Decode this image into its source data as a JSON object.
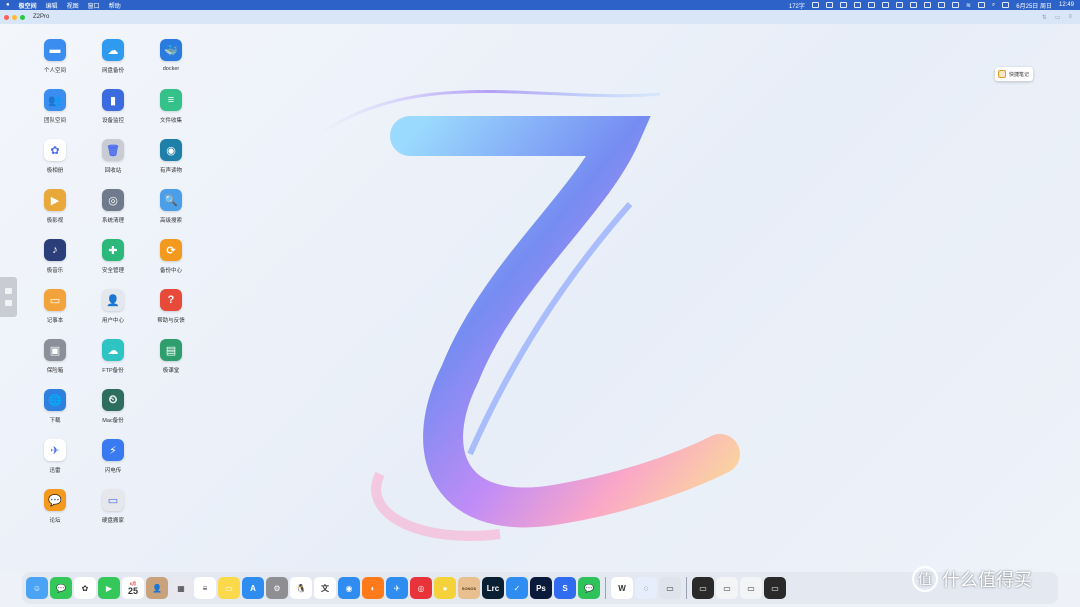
{
  "menubar": {
    "app_name": "极空间",
    "items": [
      "编辑",
      "视图",
      "窗口",
      "帮助"
    ],
    "status": {
      "input_method": "172字",
      "datetime": "6月25日 周日",
      "time": "12:49"
    }
  },
  "titlebar": {
    "device_name": "Z2Pro",
    "traffic_colors": [
      "#ff5f57",
      "#febc2e",
      "#28c840"
    ]
  },
  "desktop_apps": [
    {
      "label": "个人空间",
      "icon": "folder-icon",
      "color": "#3b8ef0",
      "glyph": "▬"
    },
    {
      "label": "网盘备份",
      "icon": "cloud-download-icon",
      "color": "#2f9bf0",
      "glyph": "☁"
    },
    {
      "label": "docker",
      "icon": "docker-icon",
      "color": "#2a7bdf",
      "glyph": "🐳"
    },
    {
      "label": "团队空间",
      "icon": "team-folder-icon",
      "color": "#3b8ef0",
      "glyph": "👥"
    },
    {
      "label": "设备监控",
      "icon": "bar-chart-icon",
      "color": "#3a6ce0",
      "glyph": "▮"
    },
    {
      "label": "文件收集",
      "icon": "file-stack-icon",
      "color": "#34c28a",
      "glyph": "≡"
    },
    {
      "label": "极相册",
      "icon": "photos-icon",
      "color": "#ffffff",
      "glyph": "✿"
    },
    {
      "label": "回收站",
      "icon": "trash-icon",
      "color": "#c9ccd2",
      "glyph": "🗑"
    },
    {
      "label": "有声读物",
      "icon": "audiobook-icon",
      "color": "#1e7fa8",
      "glyph": "◉"
    },
    {
      "label": "极影视",
      "icon": "video-icon",
      "color": "#e8a93a",
      "glyph": "▶"
    },
    {
      "label": "系统清理",
      "icon": "cleanup-icon",
      "color": "#6f7b8c",
      "glyph": "◎"
    },
    {
      "label": "高级搜索",
      "icon": "search-icon",
      "color": "#4b9ee8",
      "glyph": "🔍"
    },
    {
      "label": "极音乐",
      "icon": "music-icon",
      "color": "#2c3e7a",
      "glyph": "♪"
    },
    {
      "label": "安全管理",
      "icon": "shield-icon",
      "color": "#2cb87a",
      "glyph": "✚"
    },
    {
      "label": "备份中心",
      "icon": "backup-sync-icon",
      "color": "#f39a1e",
      "glyph": "⟳"
    },
    {
      "label": "记事本",
      "icon": "notepad-icon",
      "color": "#f3a33b",
      "glyph": "▭"
    },
    {
      "label": "用户中心",
      "icon": "user-avatar-icon",
      "color": "#e4e7ec",
      "glyph": "👤"
    },
    {
      "label": "帮助与反馈",
      "icon": "help-lifebuoy-icon",
      "color": "#e84a3a",
      "glyph": "?"
    },
    {
      "label": "保险箱",
      "icon": "safe-icon",
      "color": "#8a8f99",
      "glyph": "▣"
    },
    {
      "label": "FTP备份",
      "icon": "ftp-cloud-icon",
      "color": "#2fc4c4",
      "glyph": "☁"
    },
    {
      "label": "极课堂",
      "icon": "classroom-icon",
      "color": "#2f9e6e",
      "glyph": "▤"
    },
    {
      "label": "下载",
      "icon": "download-globe-icon",
      "color": "#2f7fe0",
      "glyph": "🌐"
    },
    {
      "label": "Mac备份",
      "icon": "time-machine-icon",
      "color": "#2e6e5e",
      "glyph": "⏲"
    },
    null,
    {
      "label": "迅雷",
      "icon": "thunder-bird-icon",
      "color": "#ffffff",
      "glyph": "✈"
    },
    {
      "label": "闪电传",
      "icon": "flash-transfer-icon",
      "color": "#3a7af0",
      "glyph": "⚡"
    },
    null,
    {
      "label": "论坛",
      "icon": "forum-chat-icon",
      "color": "#f39a1e",
      "glyph": "💬"
    },
    {
      "label": "硬盘搬家",
      "icon": "disk-move-icon",
      "color": "#e5e7eb",
      "glyph": "▭"
    },
    null
  ],
  "quick_note": {
    "label": "快捷笔记"
  },
  "dock": {
    "items": [
      {
        "name": "finder-icon",
        "color": "#4aa3f5",
        "glyph": "☺"
      },
      {
        "name": "messages-icon",
        "color": "#34c759",
        "glyph": "💬"
      },
      {
        "name": "photos-icon",
        "color": "#ffffff",
        "glyph": "✿"
      },
      {
        "name": "facetime-icon",
        "color": "#34c759",
        "glyph": "▶"
      },
      {
        "name": "calendar-icon",
        "color": "#ffffff",
        "glyph": "25",
        "calendar": true
      },
      {
        "name": "contacts-icon",
        "color": "#c8a27a",
        "glyph": "👤"
      },
      {
        "name": "launchpad-icon",
        "color": "#e8e8ee",
        "glyph": "▦"
      },
      {
        "name": "reminders-icon",
        "color": "#ffffff",
        "glyph": "≡"
      },
      {
        "name": "notes-icon",
        "color": "#fbd94a",
        "glyph": "▭"
      },
      {
        "name": "app-store-icon",
        "color": "#2f8cf0",
        "glyph": "A"
      },
      {
        "name": "system-settings-icon",
        "color": "#8e8e93",
        "glyph": "⚙"
      },
      {
        "name": "qq-icon",
        "color": "#ffffff",
        "glyph": "🐧"
      },
      {
        "name": "text-editor-icon",
        "color": "#ffffff",
        "glyph": "文"
      },
      {
        "name": "safari-icon",
        "color": "#2f8cf0",
        "glyph": "◉"
      },
      {
        "name": "firefox-icon",
        "color": "#ff7a1a",
        "glyph": "◐"
      },
      {
        "name": "dingtalk-icon",
        "color": "#2f8cf0",
        "glyph": "✈"
      },
      {
        "name": "netease-music-icon",
        "color": "#e8333a",
        "glyph": "◎"
      },
      {
        "name": "green-app-icon",
        "color": "#f5d13a",
        "glyph": "●"
      },
      {
        "name": "sonos-icon",
        "color": "#e8c090",
        "glyph": "S",
        "text": "SONOS"
      },
      {
        "name": "lightroom-icon",
        "color": "#0a2033",
        "glyph": "Lrc"
      },
      {
        "name": "tick-icon",
        "color": "#2f8cf0",
        "glyph": "✓"
      },
      {
        "name": "photoshop-icon",
        "color": "#0a1a3a",
        "glyph": "Ps"
      },
      {
        "name": "shortcuts-icon",
        "color": "#2f6cf0",
        "glyph": "S"
      },
      {
        "name": "wechat-icon",
        "color": "#2ec25a",
        "glyph": "💬"
      },
      {
        "sep": true
      },
      {
        "name": "wps-icon",
        "color": "#ffffff",
        "glyph": "W"
      },
      {
        "name": "zspace-icon",
        "color": "#e6eefc",
        "glyph": "◌"
      },
      {
        "name": "window-thumb-1-icon",
        "color": "#dfe4ec",
        "glyph": "▭"
      },
      {
        "sep": true
      },
      {
        "name": "window-thumb-2-icon",
        "color": "#2a2a2a",
        "glyph": "▭"
      },
      {
        "name": "window-thumb-3-icon",
        "color": "#f3f4f6",
        "glyph": "▭"
      },
      {
        "name": "window-thumb-4-icon",
        "color": "#f3f4f6",
        "glyph": "▭"
      },
      {
        "name": "window-thumb-5-icon",
        "color": "#2a2a2a",
        "glyph": "▭"
      }
    ]
  },
  "watermark": {
    "text": "什么值得买",
    "logo": "值"
  }
}
